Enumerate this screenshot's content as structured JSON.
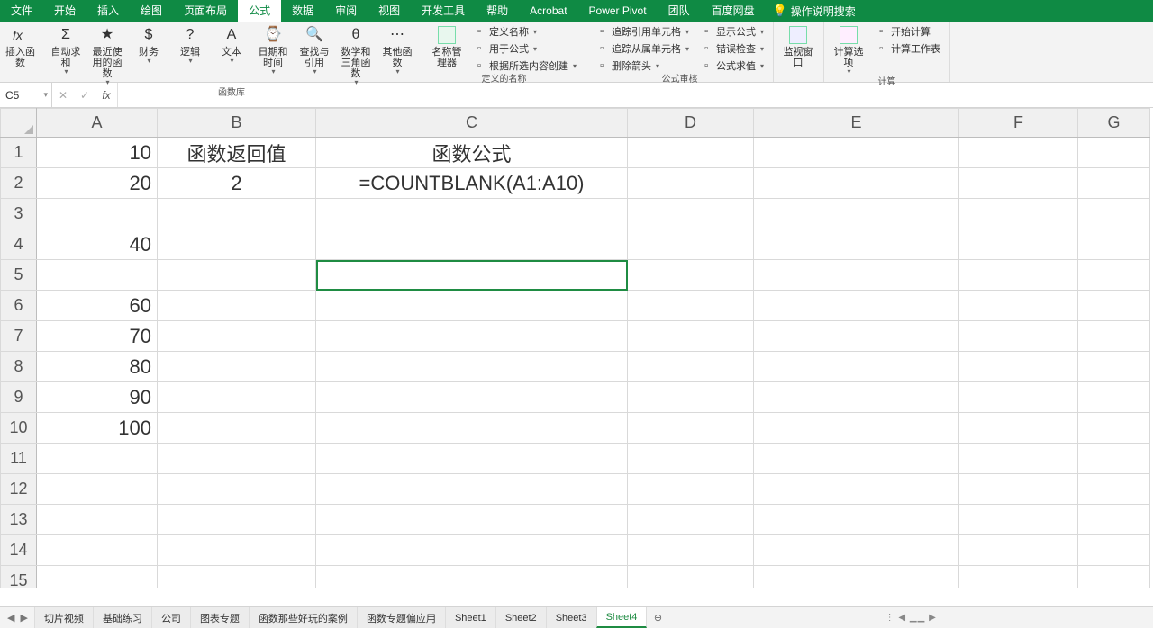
{
  "tabs": {
    "items": [
      "文件",
      "开始",
      "插入",
      "绘图",
      "页面布局",
      "公式",
      "数据",
      "审阅",
      "视图",
      "开发工具",
      "帮助",
      "Acrobat",
      "Power Pivot",
      "团队",
      "百度网盘"
    ],
    "active_index": 5,
    "tell_me": "操作说明搜索"
  },
  "ribbon": {
    "g1": {
      "insert_fx": "插入函数"
    },
    "g2": {
      "btns": [
        "自动求和",
        "最近使用的函数",
        "财务",
        "逻辑",
        "文本",
        "日期和时间",
        "查找与引用",
        "数学和三角函数",
        "其他函数"
      ],
      "label": "函数库"
    },
    "g3": {
      "main": "名称管理器",
      "items": [
        "定义名称",
        "用于公式",
        "根据所选内容创建"
      ],
      "label": "定义的名称"
    },
    "g4": {
      "items": [
        "追踪引用单元格",
        "追踪从属单元格",
        "删除箭头"
      ],
      "right": [
        "显示公式",
        "错误检查",
        "公式求值"
      ],
      "label": "公式审核"
    },
    "g5": {
      "main": "监视窗口"
    },
    "g6": {
      "main": "计算选项",
      "items": [
        "开始计算",
        "计算工作表"
      ],
      "label": "计算"
    }
  },
  "formula_bar": {
    "name_box": "C5",
    "fx_value": ""
  },
  "grid": {
    "cols": [
      "A",
      "B",
      "C",
      "D",
      "E",
      "F",
      "G"
    ],
    "rows": 15,
    "selected": {
      "row": 5,
      "col": 3
    },
    "cells": {
      "A1": "10",
      "A2": "20",
      "A4": "40",
      "A6": "60",
      "A7": "70",
      "A8": "80",
      "A9": "90",
      "A10": "100",
      "B1": "函数返回值",
      "B2": "2",
      "C1": "函数公式",
      "C2": "=COUNTBLANK(A1:A10)"
    }
  },
  "sheets": {
    "items": [
      "切片视频",
      "基础练习",
      "公司",
      "图表专题",
      "函数那些好玩的案例",
      "函数专题偏应用",
      "Sheet1",
      "Sheet2",
      "Sheet3",
      "Sheet4"
    ],
    "active_index": 9
  }
}
